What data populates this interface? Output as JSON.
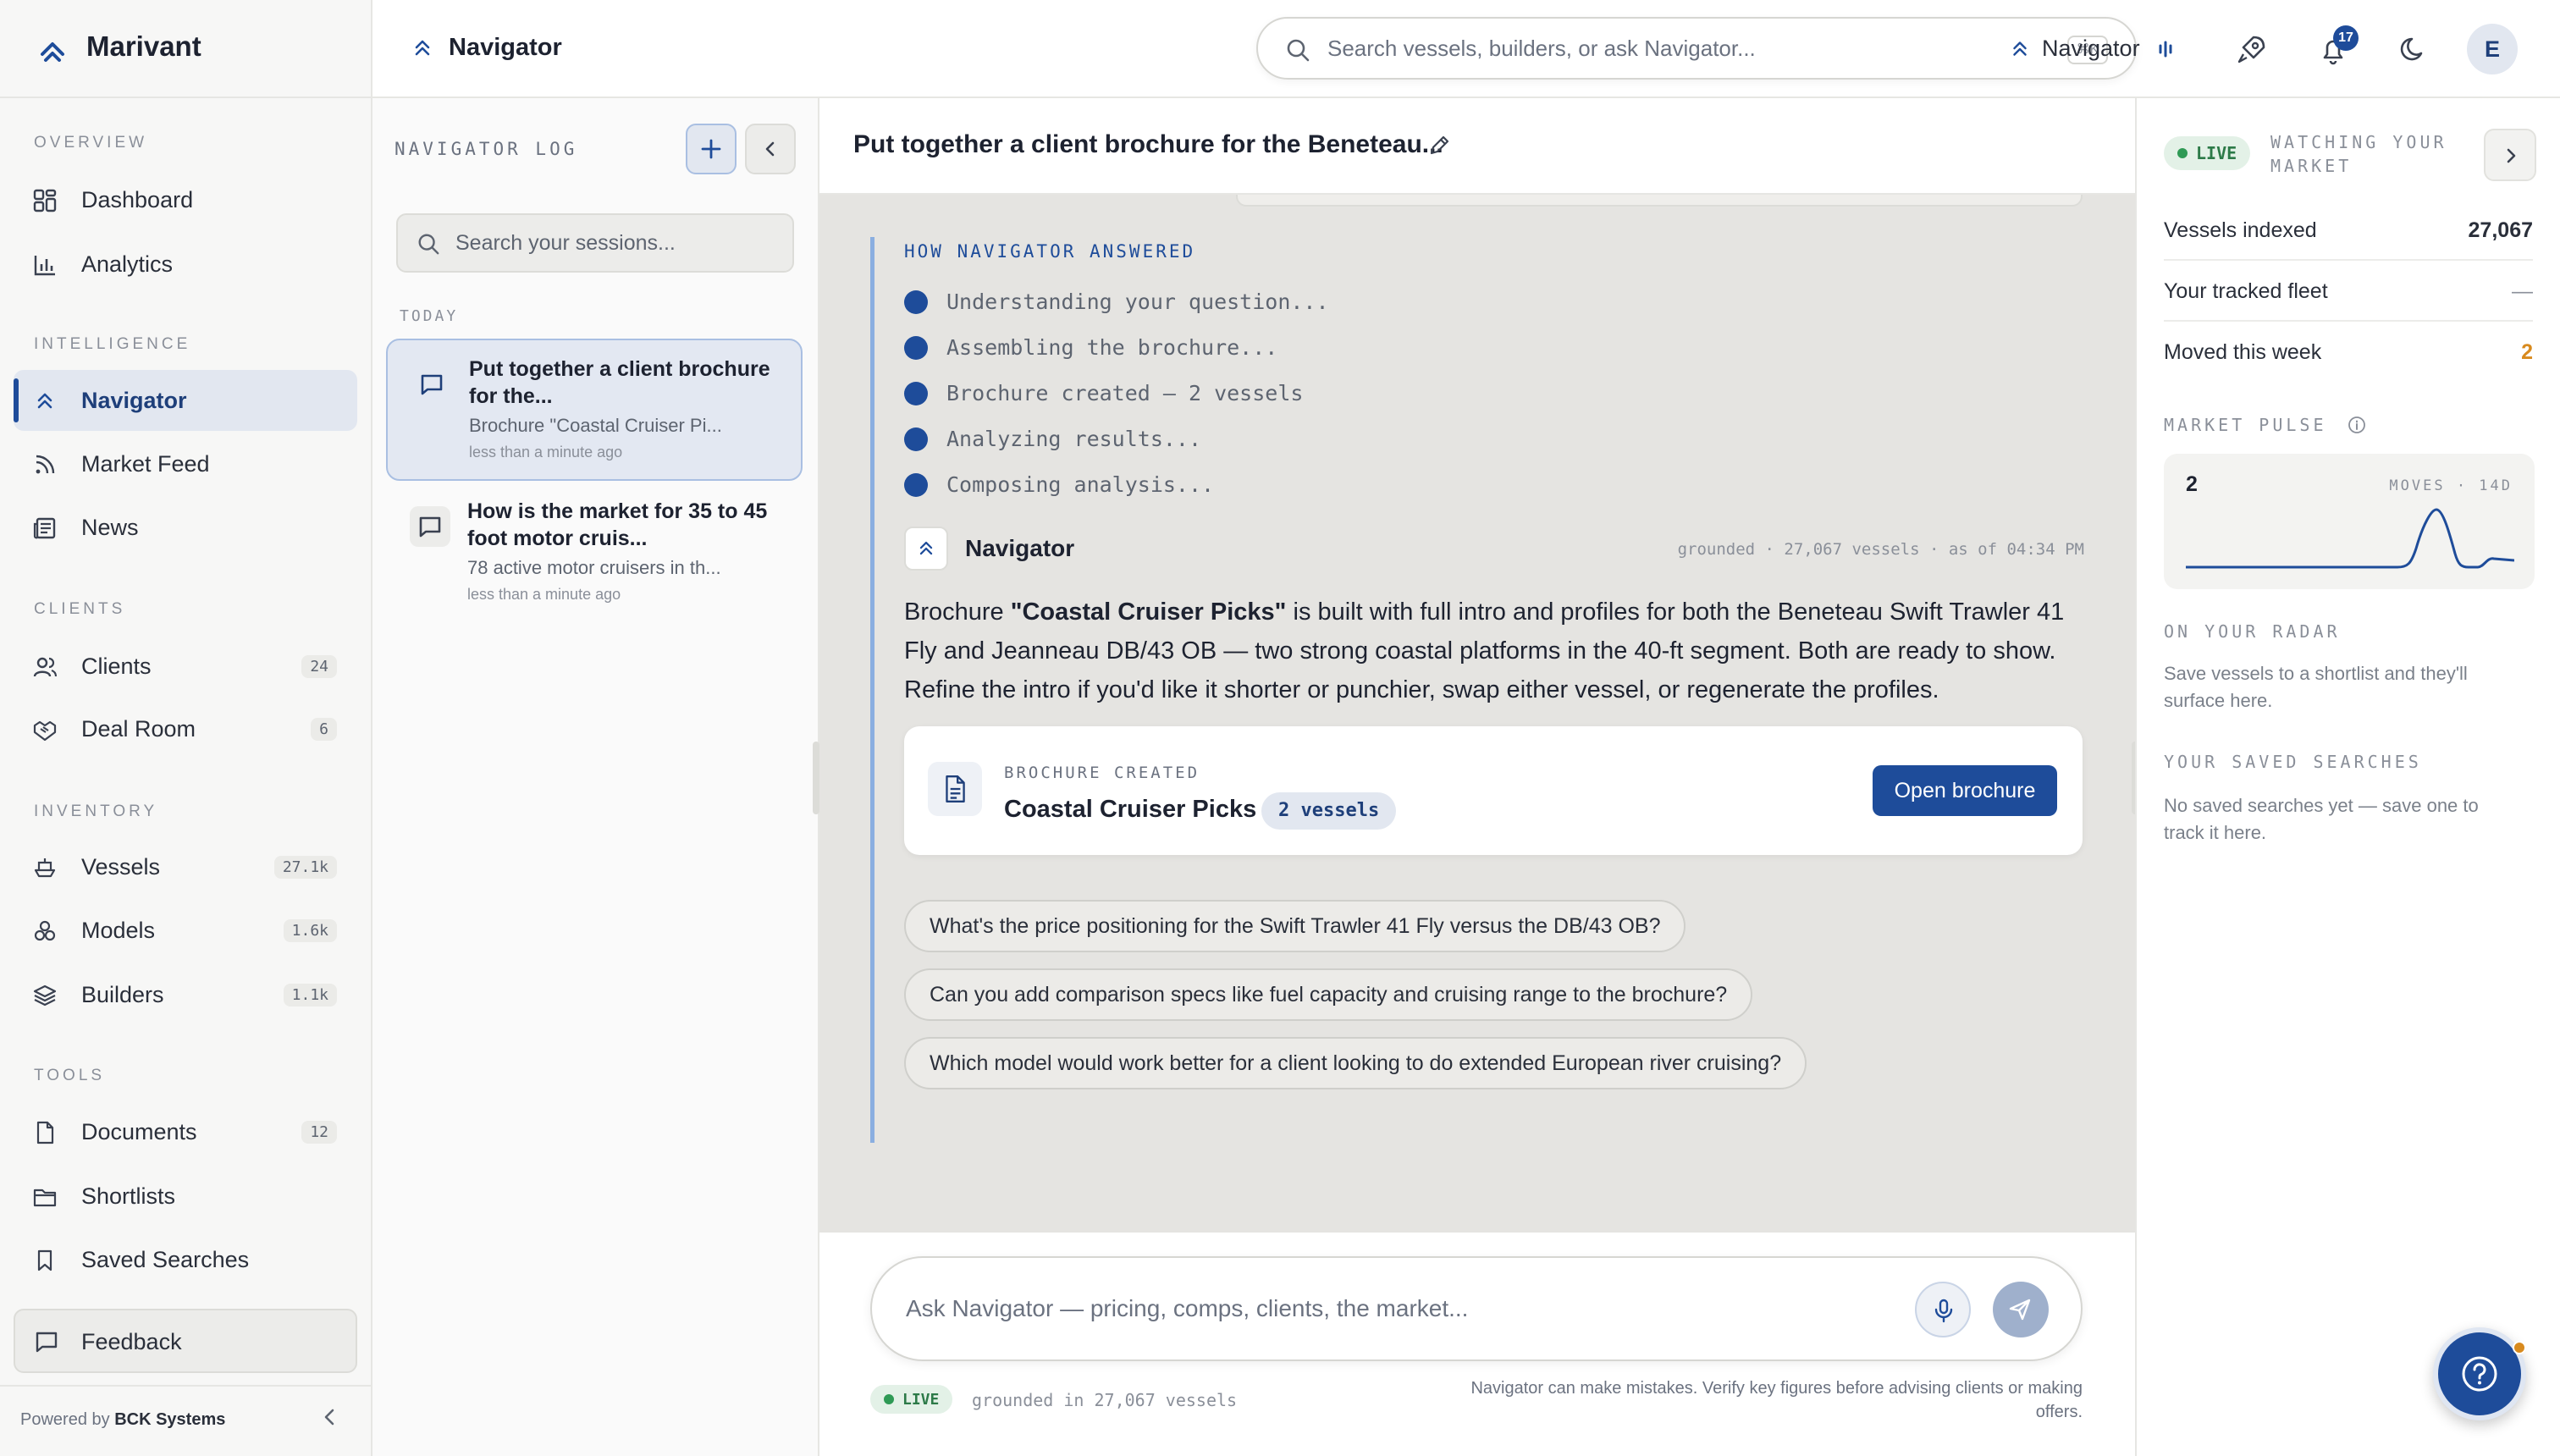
{
  "app": {
    "brand": "Marivant"
  },
  "colors": {
    "accent": "#1e4c9a",
    "live_green": "#2f9a55",
    "warning_orange": "#d88a1e"
  },
  "sidebar": {
    "sections": {
      "overview": "OVERVIEW",
      "intelligence": "INTELLIGENCE",
      "clients": "CLIENTS",
      "inventory": "INVENTORY",
      "tools": "TOOLS"
    },
    "items": [
      {
        "label": "Dashboard",
        "icon": "dashboard-icon"
      },
      {
        "label": "Analytics",
        "icon": "bar-chart-icon"
      },
      {
        "label": "Navigator",
        "icon": "navigator-chevrons-icon",
        "active": true
      },
      {
        "label": "Market Feed",
        "icon": "rss-icon"
      },
      {
        "label": "News",
        "icon": "newspaper-icon"
      },
      {
        "label": "Clients",
        "icon": "users-icon",
        "count": "24"
      },
      {
        "label": "Deal Room",
        "icon": "handshake-icon",
        "count": "6"
      },
      {
        "label": "Vessels",
        "icon": "ship-icon",
        "count": "27.1k"
      },
      {
        "label": "Models",
        "icon": "models-icon",
        "count": "1.6k"
      },
      {
        "label": "Builders",
        "icon": "layers-icon",
        "count": "1.1k"
      },
      {
        "label": "Documents",
        "icon": "document-icon",
        "count": "12"
      },
      {
        "label": "Shortlists",
        "icon": "folder-icon"
      },
      {
        "label": "Saved Searches",
        "icon": "bookmark-icon"
      }
    ],
    "feedback": "Feedback",
    "powered_prefix": "Powered by",
    "powered_by": "BCK Systems"
  },
  "topbar": {
    "page_title": "Navigator",
    "search_placeholder": "Search vessels, builders, or ask Navigator...",
    "shortcut": "⌘K",
    "navigator_label": "Navigator",
    "notifications_count": "17",
    "avatar_initial": "E"
  },
  "log": {
    "title": "NAVIGATOR LOG",
    "search_placeholder": "Search your sessions...",
    "group_today": "TODAY",
    "sessions": [
      {
        "title": "Put together a client brochure for the...",
        "subtitle": "Brochure \"Coastal Cruiser Pi...",
        "time": "less than a minute ago"
      },
      {
        "title": "How is the market for 35 to 45 foot motor cruis...",
        "subtitle": "78 active motor cruisers in th...",
        "time": "less than a minute ago"
      }
    ]
  },
  "chat": {
    "title": "Put together a client brochure for the Beneteau...",
    "how_answered": "HOW NAVIGATOR ANSWERED",
    "steps": [
      "Understanding your question...",
      "Assembling the brochure...",
      "Brochure created — 2 vessels",
      "Analyzing results...",
      "Composing analysis..."
    ],
    "responder": "Navigator",
    "meta": "grounded · 27,067 vessels · as of 04:34 PM",
    "answer_pre": "Brochure ",
    "answer_bold": "\"Coastal Cruiser Picks\"",
    "answer_post": " is built with full intro and profiles for both the Beneteau Swift Trawler 41 Fly and Jeanneau DB/43 OB — two strong coastal platforms in the 40-ft segment. Both are ready to show. Refine the intro if you'd like it shorter or punchier, swap either vessel, or regenerate the profiles.",
    "brochure": {
      "label": "BROCHURE CREATED",
      "name": "Coastal Cruiser Picks",
      "count": "2 vessels",
      "button": "Open brochure"
    },
    "suggestions": [
      "What's the price positioning for the Swift Trawler 41 Fly versus the DB/43 OB?",
      "Can you add comparison specs like fuel capacity and cruising range to the brochure?",
      "Which model would work better for a client looking to do extended European river cruising?"
    ],
    "composer_placeholder": "Ask Navigator — pricing, comps, clients, the market...",
    "live": "LIVE",
    "grounded": "grounded in 27,067 vessels",
    "disclaimer": "Navigator can make mistakes. Verify key figures before advising clients or making offers."
  },
  "right": {
    "live": "LIVE",
    "watching": "WATCHING YOUR MARKET",
    "stats": [
      {
        "label": "Vessels indexed",
        "value": "27,067"
      },
      {
        "label": "Your tracked fleet",
        "value": "—"
      },
      {
        "label": "Moved this week",
        "value": "2"
      }
    ],
    "pulse_label": "MARKET PULSE",
    "pulse_value": "2",
    "pulse_caption": "MOVES · 14D",
    "radar_label": "ON YOUR RADAR",
    "radar_text": "Save vessels to a shortlist and they'll surface here.",
    "saved_label": "YOUR SAVED SEARCHES",
    "saved_text": "No saved searches yet — save one to track it here."
  }
}
